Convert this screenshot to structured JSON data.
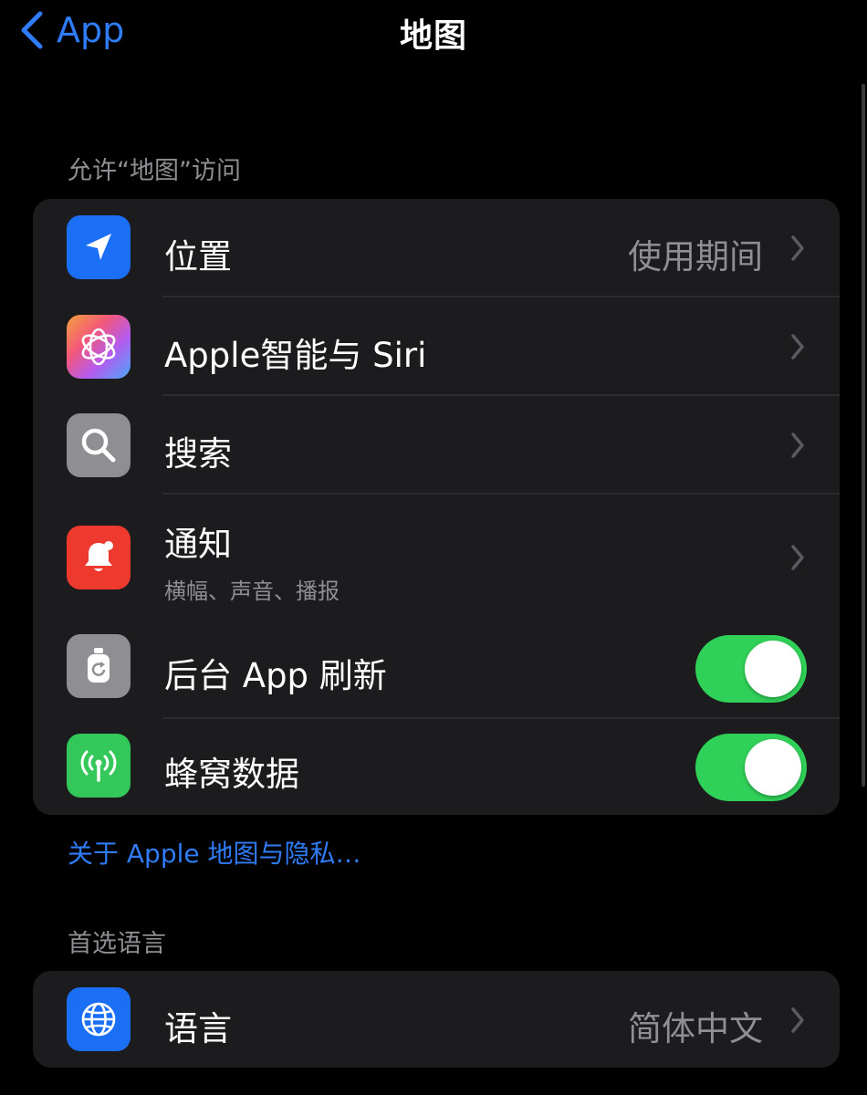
{
  "nav": {
    "back_label": "App",
    "title": "地图",
    "back_icon": "chevron-left-icon"
  },
  "access_section": {
    "header": "允许“地图”访问",
    "rows": [
      {
        "title": "位置",
        "value": "使用期间",
        "icon": "location-arrow-icon",
        "icon_color": "#1a6ff5"
      },
      {
        "title": "Apple智能与 Siri",
        "icon": "apple-intelligence-icon"
      },
      {
        "title": "搜索",
        "icon": "search-icon",
        "icon_color": "#8e8e93"
      },
      {
        "title": "通知",
        "subtitle": "横幅、声音、播报",
        "icon": "bell-icon",
        "icon_color": "#ee3a2e"
      },
      {
        "title": "后台 App 刷新",
        "toggle_on": true,
        "icon": "background-refresh-icon",
        "icon_color": "#8e8e93"
      },
      {
        "title": "蜂窝数据",
        "toggle_on": true,
        "icon": "cellular-antenna-icon",
        "icon_color": "#34c759"
      }
    ]
  },
  "privacy_link": "关于 Apple 地图与隐私…",
  "language_section": {
    "header": "首选语言",
    "rows": [
      {
        "title": "语言",
        "value": "简体中文",
        "icon": "globe-icon",
        "icon_color": "#1a6ff5"
      }
    ]
  },
  "colors": {
    "background": "#000000",
    "group_background": "#1c1c1e",
    "accent_blue": "#2f7cf6",
    "toggle_green": "#30d158",
    "secondary_text": "#8e8e93"
  }
}
